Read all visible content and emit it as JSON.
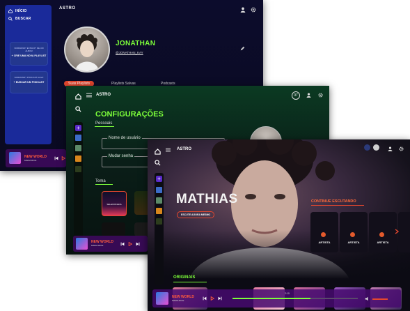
{
  "profile_window": {
    "app_title": "ASTRO",
    "nav": [
      {
        "label": "INÍCIO",
        "icon": "home-icon"
      },
      {
        "label": "BUSCAR",
        "icon": "search-icon"
      }
    ],
    "playlist_card": {
      "text": "NORMANDY EXPLICIT DE UM ÁLBUM",
      "button": "+ CRIE UMA NOVA PLAYLIST"
    },
    "podcast_card": {
      "text": "NORMANDY PODCAST ALGO",
      "button": "+ BUSCAR UM PODCAST"
    },
    "user_name": "JONATHAN",
    "user_handle": "@JONATHAN_KAY",
    "tabs": [
      "Suas Playlists",
      "Playlists Salvas",
      "Podcasts"
    ],
    "player": {
      "song": "NEW WORLD",
      "artist": "MARIA RICE"
    }
  },
  "settings_window": {
    "app_title": "ASTRO",
    "badge": "07",
    "heading": "CONFIGURAÇÕES",
    "section_personal": "Pessoais",
    "username_label": "Nome de usuário",
    "password_label": "Mudar senha",
    "theme_label": "Tema",
    "theme_option": "SELECIONADA",
    "player": {
      "song": "NEW WORLD",
      "artist": "MARIA RICE"
    }
  },
  "artist_window": {
    "app_title": "ASTRO",
    "artist_name": "MATHIAS",
    "follow_button": "ESCUTE AGORA MESMO",
    "continue_heading": "CONTINUE ESCUTANDO",
    "cards": [
      "ARTISTA",
      "ARTISTA",
      "ARTISTA"
    ],
    "originals_heading": "ORIGINAIS",
    "player": {
      "song": "NEW WORLD",
      "artist": "MARIA RICE",
      "time": "2:10"
    }
  },
  "colors": {
    "profile_bg": "#0c0c2c",
    "sidebar_blue": "#1a2a9a",
    "settings_bg": "#0b3a22",
    "neon_green": "#7dff3a",
    "player_purple": "#3c0a5a",
    "accent_red": "#e5472e"
  }
}
